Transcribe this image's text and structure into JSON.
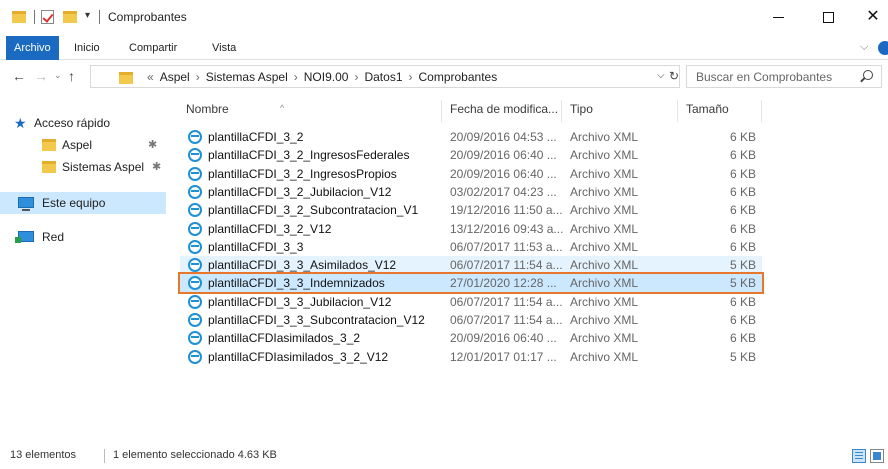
{
  "window": {
    "title": "Comprobantes",
    "quick_access_dropdown": "▾",
    "minimize_label": "",
    "maximize_label": "",
    "close_label": "✕"
  },
  "ribbon": {
    "tabs": [
      "Archivo",
      "Inicio",
      "Compartir",
      "Vista"
    ],
    "active_tab": "Archivo",
    "accent_color": "#1a6ac2"
  },
  "address": {
    "lead": "«",
    "breadcrumbs": [
      "Aspel",
      "Sistemas Aspel",
      "NOI9.00",
      "Datos1",
      "Comprobantes"
    ],
    "separator": "›",
    "dropdown": "⌵",
    "refresh": "↻",
    "nav": {
      "back": "←",
      "forward": "→",
      "recent": "⌄",
      "up": "↑"
    }
  },
  "search": {
    "placeholder": "Buscar en Comprobantes",
    "icon": "search-icon"
  },
  "navpane": {
    "quick_access": "Acceso rápido",
    "pinned": [
      {
        "label": "Aspel",
        "icon": "folder-icon",
        "pinned": true
      },
      {
        "label": "Sistemas Aspel",
        "icon": "folder-icon",
        "pinned": true
      }
    ],
    "this_pc": "Este equipo",
    "network": "Red",
    "pin_glyph": "✱"
  },
  "columns": {
    "name": "Nombre",
    "date": "Fecha de modifica...",
    "type": "Tipo",
    "size": "Tamaño",
    "sort_glyph": "^"
  },
  "files": [
    {
      "name": "plantillaCFDI_3_2",
      "date": "20/09/2016 04:53 ...",
      "type": "Archivo XML",
      "size": "6 KB",
      "state": ""
    },
    {
      "name": "plantillaCFDI_3_2_IngresosFederales",
      "date": "20/09/2016 06:40 ...",
      "type": "Archivo XML",
      "size": "6 KB",
      "state": ""
    },
    {
      "name": "plantillaCFDI_3_2_IngresosPropios",
      "date": "20/09/2016 06:40 ...",
      "type": "Archivo XML",
      "size": "6 KB",
      "state": ""
    },
    {
      "name": "plantillaCFDI_3_2_Jubilacion_V12",
      "date": "03/02/2017 04:23 ...",
      "type": "Archivo XML",
      "size": "6 KB",
      "state": ""
    },
    {
      "name": "plantillaCFDI_3_2_Subcontratacion_V1",
      "date": "19/12/2016 11:50 a...",
      "type": "Archivo XML",
      "size": "6 KB",
      "state": ""
    },
    {
      "name": "plantillaCFDI_3_2_V12",
      "date": "13/12/2016 09:43 a...",
      "type": "Archivo XML",
      "size": "6 KB",
      "state": ""
    },
    {
      "name": "plantillaCFDI_3_3",
      "date": "06/07/2017 11:53 a...",
      "type": "Archivo XML",
      "size": "6 KB",
      "state": ""
    },
    {
      "name": "plantillaCFDI_3_3_Asimilados_V12",
      "date": "06/07/2017 11:54 a...",
      "type": "Archivo XML",
      "size": "5 KB",
      "state": "hover"
    },
    {
      "name": "plantillaCFDI_3_3_Indemnizados",
      "date": "27/01/2020 12:28 ...",
      "type": "Archivo XML",
      "size": "5 KB",
      "state": "selected"
    },
    {
      "name": "plantillaCFDI_3_3_Jubilacion_V12",
      "date": "06/07/2017 11:54 a...",
      "type": "Archivo XML",
      "size": "6 KB",
      "state": ""
    },
    {
      "name": "plantillaCFDI_3_3_Subcontratacion_V12",
      "date": "06/07/2017 11:54 a...",
      "type": "Archivo XML",
      "size": "6 KB",
      "state": ""
    },
    {
      "name": "plantillaCFDIasimilados_3_2",
      "date": "20/09/2016 06:40 ...",
      "type": "Archivo XML",
      "size": "6 KB",
      "state": ""
    },
    {
      "name": "plantillaCFDIasimilados_3_2_V12",
      "date": "12/01/2017 01:17 ...",
      "type": "Archivo XML",
      "size": "5 KB",
      "state": ""
    }
  ],
  "status": {
    "count": "13 elementos",
    "selection": "1 elemento seleccionado  4.63 KB"
  },
  "colors": {
    "selected_row": "#cce8ff",
    "hover_row": "#e5f3ff",
    "selection_outline": "#e8772e",
    "folder": "#f2c94c"
  }
}
